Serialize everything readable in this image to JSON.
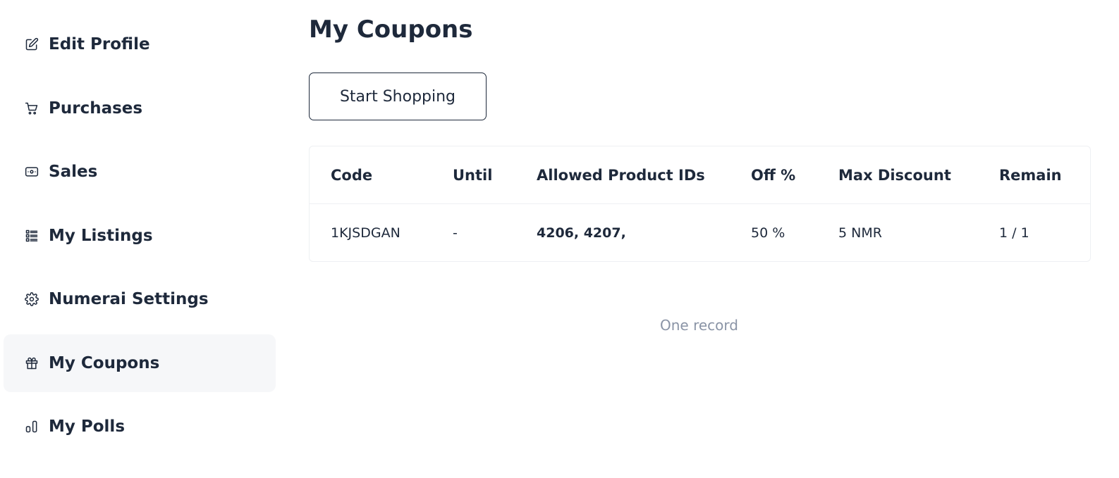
{
  "sidebar": {
    "items": [
      {
        "label": "Edit Profile",
        "icon": "edit-icon",
        "active": false
      },
      {
        "label": "Purchases",
        "icon": "cart-icon",
        "active": false
      },
      {
        "label": "Sales",
        "icon": "cash-icon",
        "active": false
      },
      {
        "label": "My Listings",
        "icon": "list-icon",
        "active": false
      },
      {
        "label": "Numerai Settings",
        "icon": "gear-icon",
        "active": false
      },
      {
        "label": "My Coupons",
        "icon": "gift-icon",
        "active": true
      },
      {
        "label": "My Polls",
        "icon": "bar-chart-icon",
        "active": false
      }
    ]
  },
  "main": {
    "title": "My Coupons",
    "start_shopping_label": "Start Shopping",
    "table": {
      "columns": [
        "Code",
        "Until",
        "Allowed Product IDs",
        "Off %",
        "Max Discount",
        "Remain"
      ],
      "rows": [
        [
          "1KJSDGAN",
          "-",
          "4206, 4207,",
          "50 %",
          "5 NMR",
          "1 / 1"
        ]
      ]
    },
    "record_count": "One record"
  },
  "colors": {
    "text": "#1e293b",
    "active_bg": "#f6f7f9",
    "muted": "#8a94a6",
    "border": "#eef0f3"
  }
}
